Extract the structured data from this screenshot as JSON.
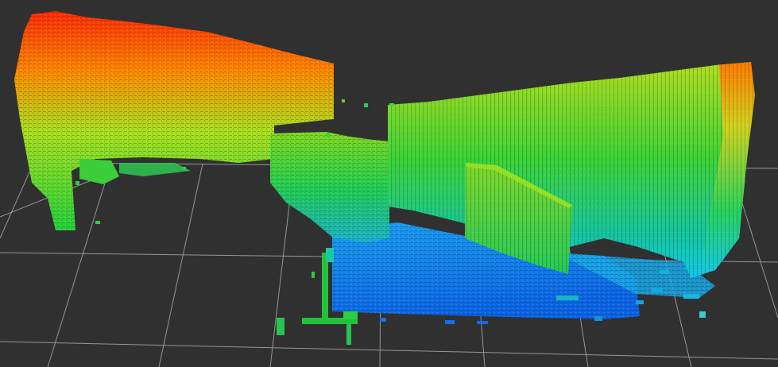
{
  "viewport": {
    "background_color": "#303030",
    "grid_color": "#a0a0a0",
    "icon": "occupancy-voxel-map",
    "colormap": [
      "#0064ff",
      "#00c8ff",
      "#00e65a",
      "#a0e61e",
      "#ffa000",
      "#ff1e00"
    ],
    "colormap_axis": "height",
    "grid_visible": true
  }
}
